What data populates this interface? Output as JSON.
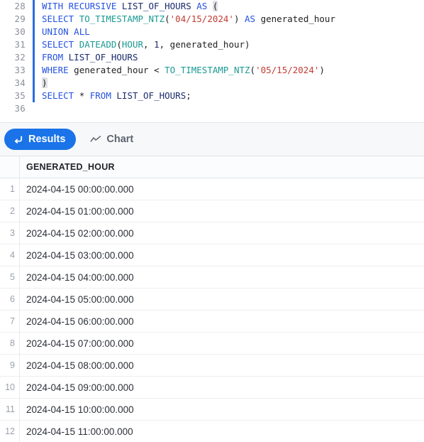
{
  "editor": {
    "first_line_number": 28,
    "lines": [
      {
        "num": "28",
        "marked": true,
        "tokens": [
          {
            "t": "WITH",
            "c": "kw"
          },
          {
            "t": " ",
            "c": "pun"
          },
          {
            "t": "RECURSIVE",
            "c": "kw"
          },
          {
            "t": " ",
            "c": "pun"
          },
          {
            "t": "LIST_OF_HOURS",
            "c": "obj"
          },
          {
            "t": " ",
            "c": "pun"
          },
          {
            "t": "AS",
            "c": "kw"
          },
          {
            "t": " ",
            "c": "pun"
          },
          {
            "t": "(",
            "c": "brk"
          }
        ]
      },
      {
        "num": "29",
        "marked": true,
        "tokens": [
          {
            "t": "SELECT",
            "c": "kw"
          },
          {
            "t": " ",
            "c": "pun"
          },
          {
            "t": "TO_TIMESTAMP_NTZ",
            "c": "fn"
          },
          {
            "t": "(",
            "c": "pun"
          },
          {
            "t": "'04/15/2024'",
            "c": "str"
          },
          {
            "t": ")",
            "c": "pun"
          },
          {
            "t": " ",
            "c": "pun"
          },
          {
            "t": "AS",
            "c": "kw"
          },
          {
            "t": " ",
            "c": "pun"
          },
          {
            "t": "generated_hour",
            "c": "idn"
          }
        ]
      },
      {
        "num": "30",
        "marked": true,
        "tokens": [
          {
            "t": "UNION",
            "c": "kw"
          },
          {
            "t": " ",
            "c": "pun"
          },
          {
            "t": "ALL",
            "c": "kw"
          }
        ]
      },
      {
        "num": "31",
        "marked": true,
        "tokens": [
          {
            "t": "SELECT",
            "c": "kw"
          },
          {
            "t": " ",
            "c": "pun"
          },
          {
            "t": "DATEADD",
            "c": "fn"
          },
          {
            "t": "(",
            "c": "pun"
          },
          {
            "t": "HOUR",
            "c": "fn"
          },
          {
            "t": ", ",
            "c": "pun"
          },
          {
            "t": "1",
            "c": "num"
          },
          {
            "t": ", ",
            "c": "pun"
          },
          {
            "t": "generated_hour",
            "c": "idn"
          },
          {
            "t": ")",
            "c": "pun"
          }
        ]
      },
      {
        "num": "32",
        "marked": true,
        "tokens": [
          {
            "t": "FROM",
            "c": "kw"
          },
          {
            "t": " ",
            "c": "pun"
          },
          {
            "t": "LIST_OF_HOURS",
            "c": "obj"
          }
        ]
      },
      {
        "num": "33",
        "marked": true,
        "tokens": [
          {
            "t": "WHERE",
            "c": "kw"
          },
          {
            "t": " ",
            "c": "pun"
          },
          {
            "t": "generated_hour",
            "c": "idn"
          },
          {
            "t": " ",
            "c": "pun"
          },
          {
            "t": "<",
            "c": "pun"
          },
          {
            "t": " ",
            "c": "pun"
          },
          {
            "t": "TO_TIMESTAMP_NTZ",
            "c": "fn"
          },
          {
            "t": "(",
            "c": "pun"
          },
          {
            "t": "'05/15/2024'",
            "c": "str"
          },
          {
            "t": ")",
            "c": "pun"
          }
        ]
      },
      {
        "num": "34",
        "marked": true,
        "tokens": [
          {
            "t": ")",
            "c": "brk"
          }
        ]
      },
      {
        "num": "35",
        "marked": true,
        "tokens": [
          {
            "t": "SELECT",
            "c": "kw"
          },
          {
            "t": " ",
            "c": "pun"
          },
          {
            "t": "*",
            "c": "pun"
          },
          {
            "t": " ",
            "c": "pun"
          },
          {
            "t": "FROM",
            "c": "kw"
          },
          {
            "t": " ",
            "c": "pun"
          },
          {
            "t": "LIST_OF_HOURS",
            "c": "obj"
          },
          {
            "t": ";",
            "c": "pun"
          }
        ]
      },
      {
        "num": "36",
        "marked": false,
        "tokens": []
      }
    ]
  },
  "toolbar": {
    "results_tab_label": "Results",
    "chart_tab_label": "Chart",
    "results_icon": "arrow-return-icon",
    "chart_icon": "line-chart-icon",
    "active_tab": "Results",
    "active_color": "#1a73e8"
  },
  "results": {
    "columns": [
      "GENERATED_HOUR"
    ],
    "rows": [
      {
        "n": "1",
        "values": [
          "2024-04-15 00:00:00.000"
        ]
      },
      {
        "n": "2",
        "values": [
          "2024-04-15 01:00:00.000"
        ]
      },
      {
        "n": "3",
        "values": [
          "2024-04-15 02:00:00.000"
        ]
      },
      {
        "n": "4",
        "values": [
          "2024-04-15 03:00:00.000"
        ]
      },
      {
        "n": "5",
        "values": [
          "2024-04-15 04:00:00.000"
        ]
      },
      {
        "n": "6",
        "values": [
          "2024-04-15 05:00:00.000"
        ]
      },
      {
        "n": "7",
        "values": [
          "2024-04-15 06:00:00.000"
        ]
      },
      {
        "n": "8",
        "values": [
          "2024-04-15 07:00:00.000"
        ]
      },
      {
        "n": "9",
        "values": [
          "2024-04-15 08:00:00.000"
        ]
      },
      {
        "n": "10",
        "values": [
          "2024-04-15 09:00:00.000"
        ]
      },
      {
        "n": "11",
        "values": [
          "2024-04-15 10:00:00.000"
        ]
      },
      {
        "n": "12",
        "values": [
          "2024-04-15 11:00:00.000"
        ]
      }
    ]
  }
}
